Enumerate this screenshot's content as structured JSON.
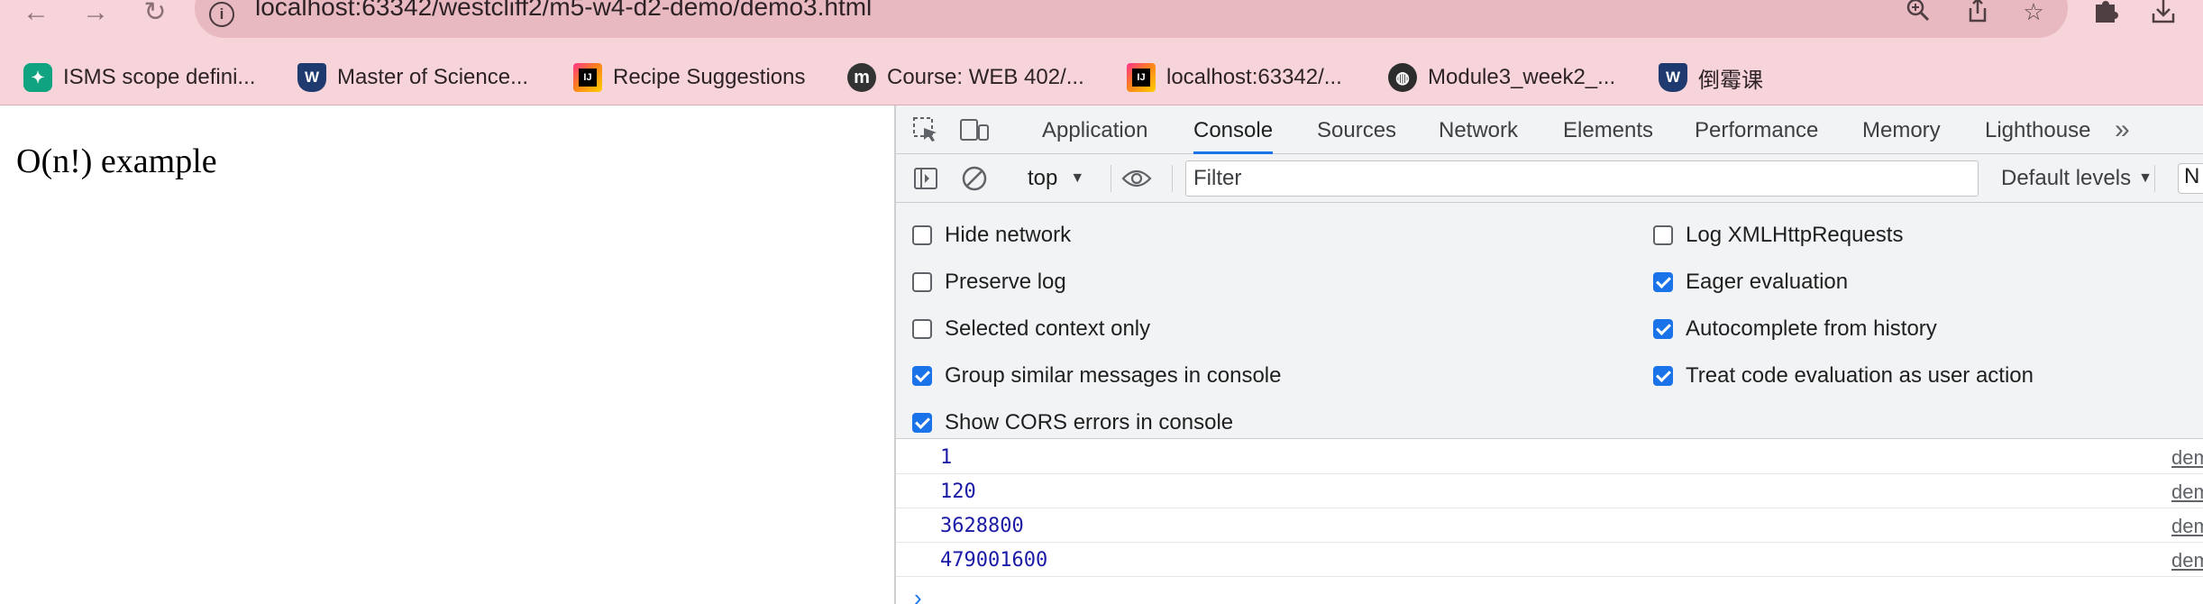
{
  "browser": {
    "url": "localhost:63342/westcliff2/m5-w4-d2-demo/demo3.html",
    "bookmarks": [
      {
        "label": "ISMS scope defini...",
        "icon": "chatgpt-icon"
      },
      {
        "label": "Master of Science...",
        "icon": "university-shield-icon"
      },
      {
        "label": "Recipe Suggestions",
        "icon": "jetbrains-icon"
      },
      {
        "label": "Course: WEB 402/...",
        "icon": "moodle-icon"
      },
      {
        "label": "localhost:63342/...",
        "icon": "jetbrains-icon"
      },
      {
        "label": "Module3_week2_...",
        "icon": "globe-icon"
      },
      {
        "label": "倒霉课",
        "icon": "university-shield-icon"
      }
    ]
  },
  "page": {
    "heading": "O(n!) example"
  },
  "devtools": {
    "tabs": [
      {
        "label": "Application",
        "active": false
      },
      {
        "label": "Console",
        "active": true
      },
      {
        "label": "Sources",
        "active": false
      },
      {
        "label": "Network",
        "active": false
      },
      {
        "label": "Elements",
        "active": false
      },
      {
        "label": "Performance",
        "active": false
      },
      {
        "label": "Memory",
        "active": false
      },
      {
        "label": "Lighthouse",
        "active": false
      }
    ],
    "toolbar": {
      "context": "top",
      "filter_placeholder": "Filter",
      "levels": "Default levels",
      "issues_partial": "N"
    },
    "settings": [
      {
        "label": "Hide network",
        "checked": false
      },
      {
        "label": "Log XMLHttpRequests",
        "checked": false
      },
      {
        "label": "Preserve log",
        "checked": false
      },
      {
        "label": "Eager evaluation",
        "checked": true
      },
      {
        "label": "Selected context only",
        "checked": false
      },
      {
        "label": "Autocomplete from history",
        "checked": true
      },
      {
        "label": "Group similar messages in console",
        "checked": true
      },
      {
        "label": "Treat code evaluation as user action",
        "checked": true
      },
      {
        "label": "Show CORS errors in console",
        "checked": true
      }
    ],
    "messages": [
      {
        "value": "1",
        "source": "dem"
      },
      {
        "value": "120",
        "source": "dem"
      },
      {
        "value": "3628800",
        "source": "dem"
      },
      {
        "value": "479001600",
        "source": "dem"
      }
    ],
    "accent_color": "#1a73e8"
  }
}
